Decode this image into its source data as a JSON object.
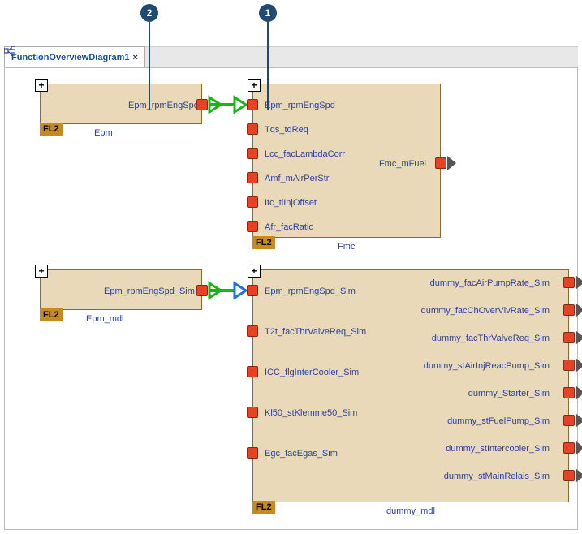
{
  "tab": {
    "title": "FunctionOverviewDiagram1",
    "close": "×"
  },
  "callouts": {
    "c1": "1",
    "c2": "2"
  },
  "fl2_label": "FL2",
  "blocks": {
    "epm": {
      "name": "Epm",
      "out": "Epm_rpmEngSpd"
    },
    "fmc": {
      "name": "Fmc",
      "in": [
        "Epm_rpmEngSpd",
        "Tqs_tqReq",
        "Lcc_facLambdaCorr",
        "Amf_mAirPerStr",
        "Itc_tiInjOffset",
        "Afr_facRatio"
      ],
      "out": [
        "Fmc_mFuel"
      ]
    },
    "epm_mdl": {
      "name": "Epm_mdl",
      "out": "Epm_rpmEngSpd_Sim"
    },
    "dummy_mdl": {
      "name": "dummy_mdl",
      "in": [
        "Epm_rpmEngSpd_Sim",
        "T2t_facThrValveReq_Sim",
        "ICC_flgInterCooler_Sim",
        "Kl50_stKlemme50_Sim",
        "Egc_facEgas_Sim"
      ],
      "out": [
        "dummy_facAirPumpRate_Sim",
        "dummy_facChOverVlvRate_Sim",
        "dummy_facThrValveReq_Sim",
        "dummy_stAirInjReacPump_Sim",
        "dummy_Starter_Sim",
        "dummy_stFuelPump_Sim",
        "dummy_stIntercooler_Sim",
        "dummy_stMainRelais_Sim"
      ]
    }
  }
}
